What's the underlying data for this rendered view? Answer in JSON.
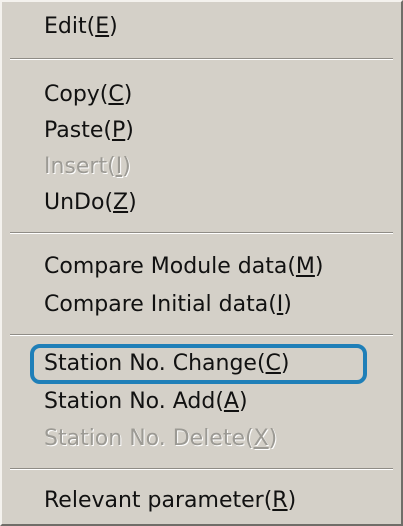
{
  "menu": {
    "items": [
      {
        "label": "Edit(",
        "key": "E",
        "close": ")",
        "enabled": true
      },
      {
        "label": "Copy(",
        "key": "C",
        "close": ")",
        "enabled": true
      },
      {
        "label": "Paste(",
        "key": "P",
        "close": ")",
        "enabled": true
      },
      {
        "label": "Insert(",
        "key": "I",
        "close": ")",
        "enabled": false
      },
      {
        "label": "UnDo(",
        "key": "Z",
        "close": ")",
        "enabled": true
      },
      {
        "label": "Compare Module data(",
        "key": "M",
        "close": ")",
        "enabled": true
      },
      {
        "label": "Compare Initial data(",
        "key": "I",
        "close": ")",
        "enabled": true
      },
      {
        "label": "Station No. Change(",
        "key": "C",
        "close": ")",
        "enabled": true
      },
      {
        "label": "Station No. Add(",
        "key": "A",
        "close": ")",
        "enabled": true
      },
      {
        "label": "Station No. Delete(",
        "key": "X",
        "close": ")",
        "enabled": false
      },
      {
        "label": "Relevant parameter(",
        "key": "R",
        "close": ")",
        "enabled": true
      }
    ],
    "highlight_color": "#1f7fb8"
  }
}
